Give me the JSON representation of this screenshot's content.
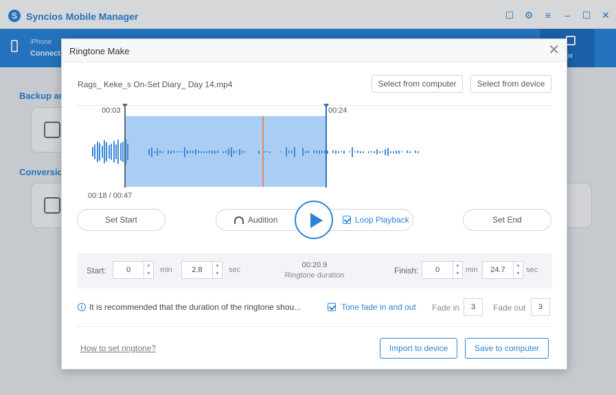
{
  "app": {
    "title": "Syncios Mobile Manager",
    "logo": "S",
    "window_controls": [
      "feedback-icon",
      "gear-icon",
      "menu-icon",
      "minimize-icon",
      "maximize-icon",
      "close-icon"
    ],
    "accent_color": "#2a82d8"
  },
  "nav": {
    "device_line1": "iPhone",
    "device_line2": "Connect",
    "toolbox_label": "box"
  },
  "background": {
    "section1": "Backup an",
    "section2": "Conversio"
  },
  "dialog": {
    "title": "Ringtone Make",
    "file_name": "Rags_ Keke_s On-Set Diary_ Day 14.mp4",
    "select_from_computer": "Select from computer",
    "select_from_device": "Select from device",
    "marker_start_time": "00:03",
    "marker_end_time": "00:24",
    "current_time": "00:18 / 00:47",
    "set_start": "Set Start",
    "audition": "Audition",
    "loop_playback": "Loop Playback",
    "loop_playback_checked": true,
    "set_end": "Set End",
    "start_label": "Start:",
    "start_min": "0",
    "min_unit": "min",
    "start_sec": "2.8",
    "sec_unit": "sec",
    "duration_value": "00:20.9",
    "duration_label": "Ringtone duration",
    "finish_label": "Finish:",
    "finish_min": "0",
    "finish_sec": "24.7",
    "info_text": "It is recommended that the duration of the ringtone shou...",
    "fade_toggle": "Tone fade in and out",
    "fade_toggle_checked": true,
    "fade_in_label": "Fade in",
    "fade_in_value": "3",
    "fade_out_label": "Fade out",
    "fade_out_value": "3",
    "help_link": "How to set ringtone?",
    "import_button": "Import to device",
    "save_button": "Save to computer"
  }
}
